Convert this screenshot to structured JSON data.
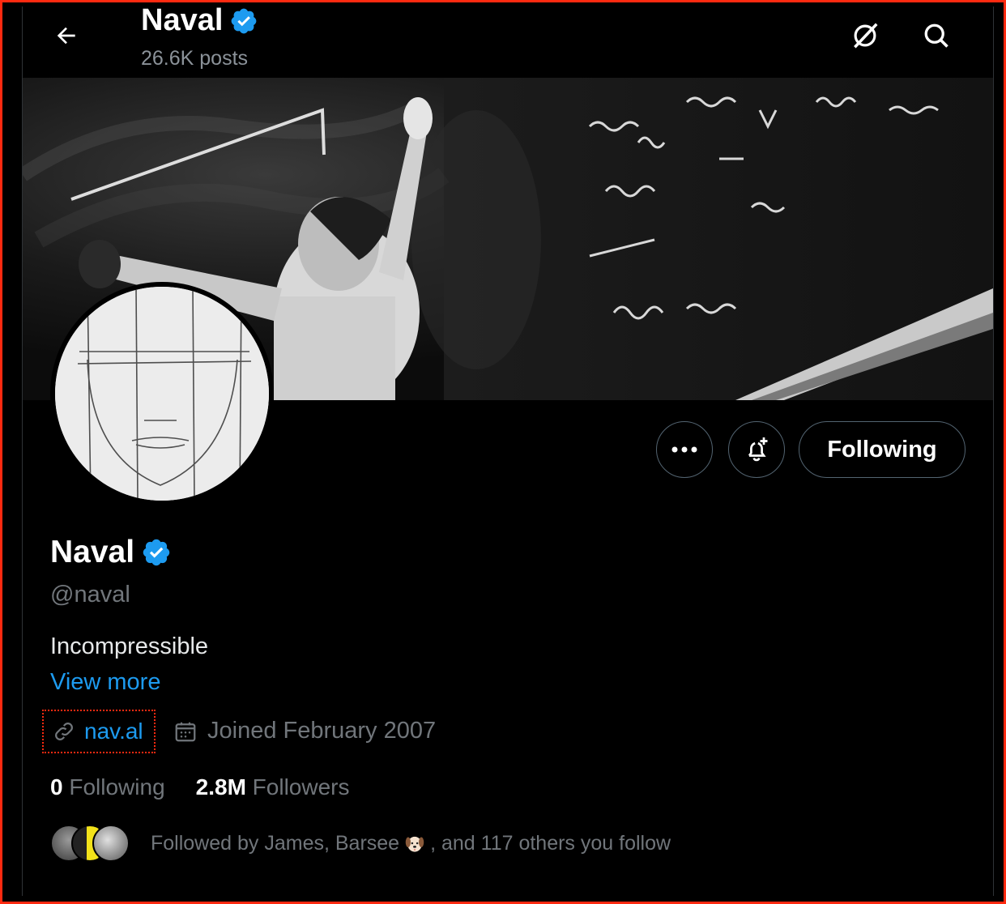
{
  "header": {
    "name": "Naval",
    "posts": "26.6K posts"
  },
  "profile": {
    "name": "Naval",
    "handle": "@naval",
    "bio": "Incompressible",
    "view_more": "View more",
    "website": "nav.al",
    "joined": "Joined February 2007",
    "following_count": "0",
    "following_label": "Following",
    "followers_count": "2.8M",
    "followers_label": "Followers",
    "followed_by_prefix": "Followed by James, Barsee",
    "followed_by_suffix": ", and 117 others you follow"
  },
  "actions": {
    "following_button": "Following"
  },
  "colors": {
    "accent": "#1d9bf0",
    "highlight_border": "#ff2a10",
    "background": "#000000"
  }
}
